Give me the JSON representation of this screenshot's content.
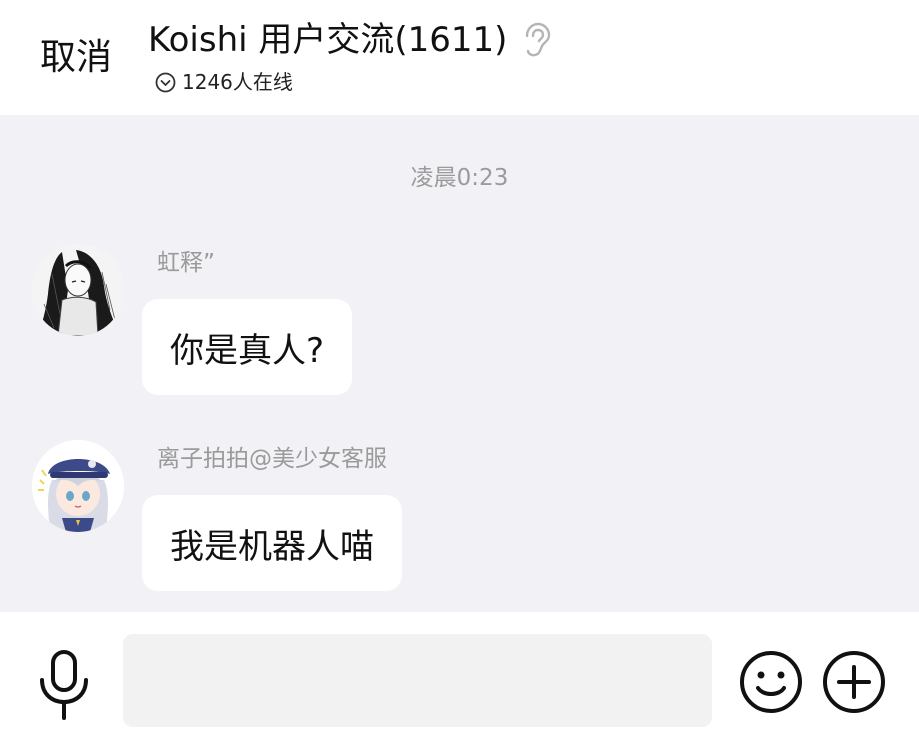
{
  "header": {
    "cancel_label": "取消",
    "title": "Koishi 用户交流(1611)",
    "online_text": "1246人在线",
    "ear_icon": "ear-icon",
    "chevron_icon": "chevron-down-circle-icon"
  },
  "chat": {
    "timestamp": "凌晨0:23",
    "messages": [
      {
        "sender": "虹释”",
        "text": "你是真人?",
        "avatar": "avatar-monochrome-girl"
      },
      {
        "sender": "离子拍拍@美少女客服",
        "text": "我是机器人喵",
        "avatar": "avatar-anime-girl-hat"
      }
    ]
  },
  "composer": {
    "input_value": "",
    "mic_icon": "microphone-icon",
    "emoji_icon": "emoji-icon",
    "plus_icon": "plus-icon"
  },
  "colors": {
    "chat_background": "#f2f1f5",
    "bubble": "#ffffff",
    "meta_text": "#9a9a9a"
  }
}
